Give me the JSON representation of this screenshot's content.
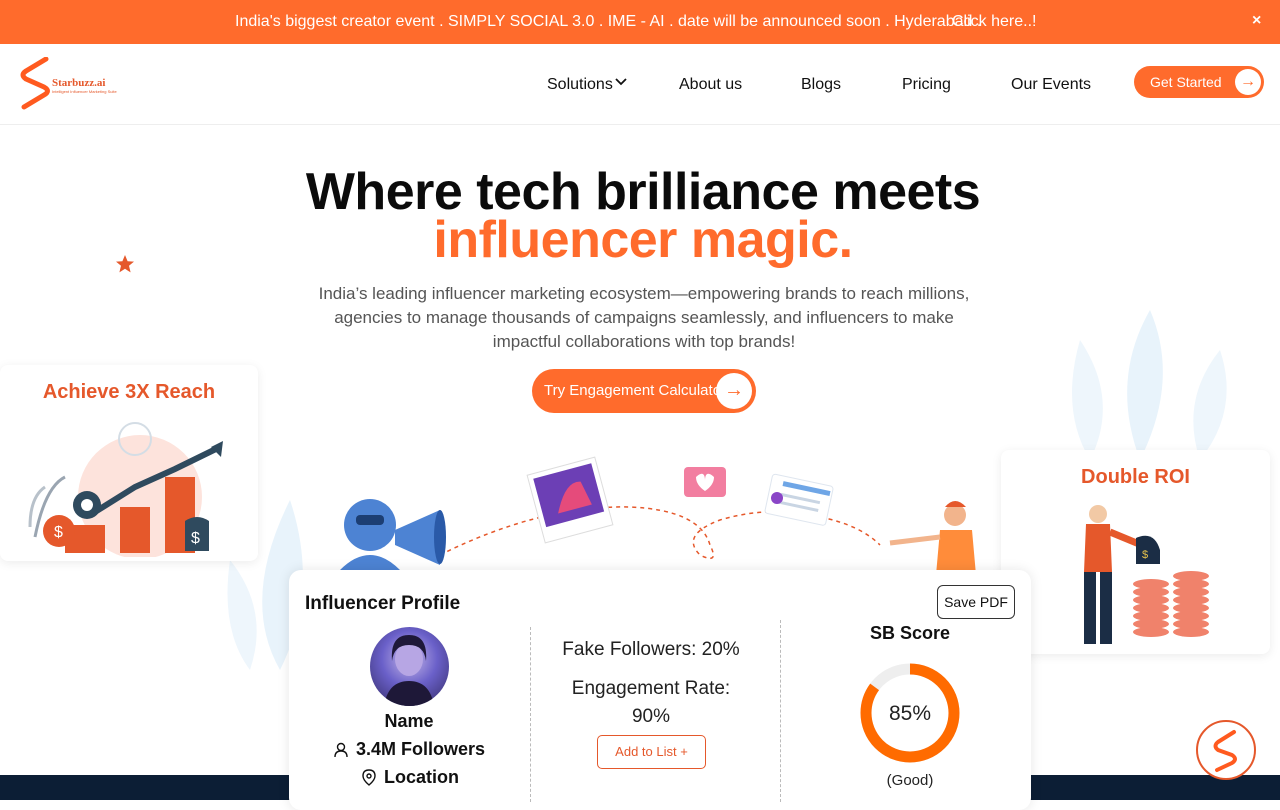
{
  "banner": {
    "text": "India's biggest creator event . SIMPLY SOCIAL 3.0 . IME - AI . date will be announced soon . Hyderabad .",
    "link": "Click here..!",
    "close": "×"
  },
  "nav": {
    "logo_text": "Starbuzz.ai",
    "logo_sub": "Intelligent Influencer Marketing Suite",
    "items": [
      "Solutions",
      "About us",
      "Blogs",
      "Pricing",
      "Our Events"
    ],
    "cta": "Get Started",
    "cta_arrow": "→"
  },
  "hero": {
    "title_line1": "Where tech brilliance meets",
    "title_line2": "influencer magic.",
    "subtitle": "India’s leading influencer marketing ecosystem—empowering brands to reach millions, agencies to manage thousands of campaigns seamlessly, and influencers to make impactful collaborations with top brands!",
    "cta": "Try Engagement Calculator",
    "cta_arrow": "→"
  },
  "cards": {
    "left_title": "Achieve 3X Reach",
    "right_title": "Double ROI"
  },
  "profile": {
    "title": "Influencer Profile",
    "save": "Save PDF",
    "name": "Name",
    "followers": "3.4M Followers",
    "location": "Location",
    "fake_followers": "Fake Followers: 20%",
    "engagement_label": "Engagement Rate:",
    "engagement_value": "90%",
    "add_to_list": "Add to List +",
    "sb_title": "SB Score",
    "sb_value": "85%",
    "sb_fraction": 0.85,
    "sb_rating": "(Good)"
  },
  "colors": {
    "accent": "#ff6b2c",
    "dark": "#0c1e35"
  }
}
